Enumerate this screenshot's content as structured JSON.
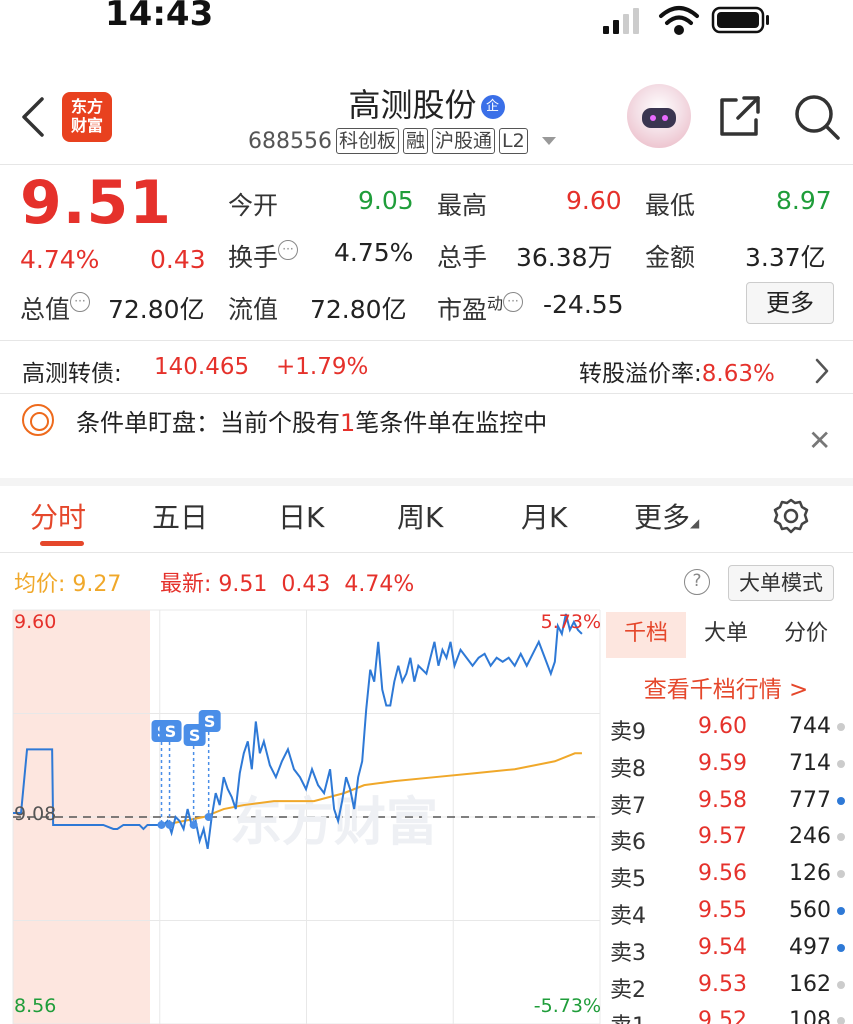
{
  "status_bar": {
    "time": "14:43"
  },
  "header": {
    "logo_line1": "东方",
    "logo_line2": "财富",
    "title": "高测股份",
    "title_badge": "企",
    "code": "688556",
    "tags": [
      "科创板",
      "融",
      "沪股通",
      "L2"
    ]
  },
  "quote": {
    "price": "9.51",
    "change_pct": "4.74%",
    "change_abs": "0.43",
    "open_label": "今开",
    "open_value": "9.05",
    "high_label": "最高",
    "high_value": "9.60",
    "low_label": "最低",
    "low_value": "8.97",
    "turnover_label": "换手",
    "turnover_value": "4.75%",
    "volume_label": "总手",
    "volume_value": "36.38万",
    "amount_label": "金额",
    "amount_value": "3.37亿",
    "mktcap_label": "总值",
    "mktcap_value": "72.80亿",
    "float_label": "流值",
    "float_value": "72.80亿",
    "pe_label": "市盈",
    "pe_sup": "动",
    "pe_value": "-24.55",
    "more_button": "更多"
  },
  "bond": {
    "label": "高测转债:",
    "price": "140.465",
    "change": "+1.79%",
    "premium_label": "转股溢价率:",
    "premium_value": "8.63%"
  },
  "alert": {
    "prefix": "条件单盯盘：当前个股有",
    "count": "1",
    "suffix": "笔条件单在监控中"
  },
  "tabs": [
    "分时",
    "五日",
    "日K",
    "周K",
    "月K",
    "更多"
  ],
  "chart_info": {
    "avg_label": "均价:",
    "avg_value": "9.27",
    "latest_label": "最新:",
    "latest_value": "9.51",
    "latest_change": "0.43",
    "latest_pct": "4.74%",
    "help_icon": "?",
    "big_order_mode": "大单模式"
  },
  "chart_data": {
    "type": "line",
    "y_max_label": "9.60",
    "y_min_label": "8.56",
    "pct_max_label": "5.73%",
    "pct_min_label": "-5.73%",
    "prev_close_label": "9.08",
    "ylim": [
      8.56,
      9.6
    ],
    "prev_close": 9.08,
    "markers": [
      "S",
      "S",
      "S",
      "S"
    ],
    "series": [
      {
        "x": [
          0,
          8,
          14,
          24,
          35,
          39,
          40,
          60,
          80,
          90,
          100,
          104,
          110,
          116,
          122,
          126,
          130,
          134,
          138,
          142,
          146,
          150,
          154,
          158,
          162,
          166,
          170,
          174,
          178,
          182,
          186,
          190,
          194,
          198,
          202,
          206,
          210,
          214,
          218,
          222,
          226,
          230,
          234,
          238,
          242,
          246,
          250,
          256,
          262,
          268,
          274,
          280,
          286,
          292,
          298,
          304,
          310,
          316,
          320,
          324,
          328,
          332,
          336,
          340,
          344,
          348,
          352,
          356,
          360,
          364,
          368,
          372,
          376,
          380,
          384,
          388,
          392,
          396,
          400,
          404,
          408,
          412,
          416,
          420,
          424,
          428,
          432,
          436,
          440,
          446,
          452,
          458,
          464,
          470,
          476,
          482,
          488,
          494,
          500,
          506,
          512,
          518,
          524,
          530,
          536,
          540,
          543,
          547,
          551,
          555,
          559,
          563,
          567
        ],
        "values": [
          9.09,
          9.09,
          9.25,
          9.25,
          9.25,
          9.25,
          9.06,
          9.06,
          9.06,
          9.06,
          9.05,
          9.05,
          9.06,
          9.06,
          9.06,
          9.06,
          9.05,
          9.06,
          9.06,
          9.06,
          9.06,
          9.06,
          9.07,
          9.04,
          9.08,
          9.07,
          9.05,
          9.1,
          9.06,
          9.07,
          9.02,
          9.05,
          9.0,
          9.08,
          9.14,
          9.11,
          9.18,
          9.15,
          9.13,
          9.1,
          9.19,
          9.24,
          9.27,
          9.2,
          9.32,
          9.24,
          9.27,
          9.21,
          9.18,
          9.22,
          9.25,
          9.2,
          9.18,
          9.15,
          9.2,
          9.16,
          9.14,
          9.2,
          9.1,
          9.07,
          9.12,
          9.18,
          9.15,
          9.1,
          9.18,
          9.22,
          9.35,
          9.45,
          9.42,
          9.52,
          9.4,
          9.36,
          9.36,
          9.42,
          9.46,
          9.42,
          9.44,
          9.48,
          9.42,
          9.46,
          9.45,
          9.44,
          9.48,
          9.52,
          9.46,
          9.5,
          9.48,
          9.52,
          9.46,
          9.5,
          9.48,
          9.46,
          9.48,
          9.49,
          9.46,
          9.48,
          9.47,
          9.48,
          9.46,
          9.49,
          9.46,
          9.49,
          9.52,
          9.48,
          9.44,
          9.47,
          9.56,
          9.54,
          9.59,
          9.55,
          9.57,
          9.55,
          9.54
        ]
      },
      {
        "name": "均价",
        "x": [
          150,
          170,
          190,
          210,
          230,
          260,
          300,
          330,
          350,
          380,
          420,
          460,
          500,
          540,
          560,
          567
        ],
        "values": [
          9.06,
          9.07,
          9.08,
          9.1,
          9.11,
          9.12,
          9.12,
          9.14,
          9.16,
          9.17,
          9.18,
          9.19,
          9.2,
          9.22,
          9.24,
          9.24
        ]
      }
    ]
  },
  "order_book": {
    "tabs": [
      "千档",
      "大单",
      "分价"
    ],
    "link": "查看千档行情 >",
    "rows": [
      {
        "name": "卖9",
        "price": "9.60",
        "vol": "744",
        "dot": "gray"
      },
      {
        "name": "卖8",
        "price": "9.59",
        "vol": "714",
        "dot": "gray"
      },
      {
        "name": "卖7",
        "price": "9.58",
        "vol": "777",
        "dot": "blue"
      },
      {
        "name": "卖6",
        "price": "9.57",
        "vol": "246",
        "dot": "gray"
      },
      {
        "name": "卖5",
        "price": "9.56",
        "vol": "126",
        "dot": "gray"
      },
      {
        "name": "卖4",
        "price": "9.55",
        "vol": "560",
        "dot": "blue"
      },
      {
        "name": "卖3",
        "price": "9.54",
        "vol": "497",
        "dot": "blue"
      },
      {
        "name": "卖2",
        "price": "9.53",
        "vol": "162",
        "dot": "gray"
      },
      {
        "name": "卖1",
        "price": "9.52",
        "vol": "108",
        "dot": "gray"
      }
    ]
  },
  "colors": {
    "up": "#e5312b",
    "down": "#1f9d3a",
    "accent": "#e5472b",
    "line": "#2e79d6",
    "avg": "#f0a82a"
  }
}
